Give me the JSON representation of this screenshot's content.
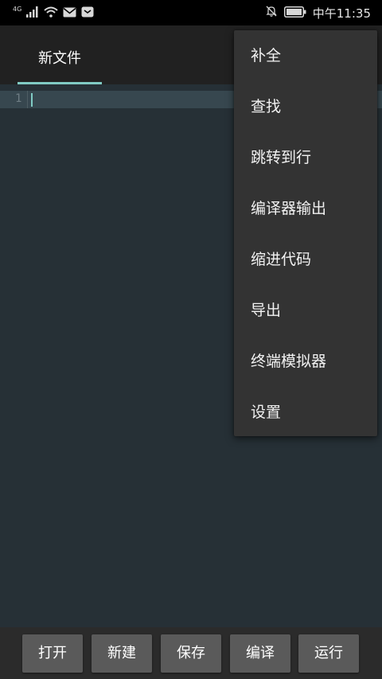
{
  "status_bar": {
    "network_label": "4G",
    "time": "中午11:35",
    "icons": [
      "signal-icon",
      "wifi-icon",
      "mail-icon",
      "notification-icon",
      "mute-icon",
      "battery-icon"
    ]
  },
  "tabs": [
    {
      "label": "新文件",
      "active": true
    }
  ],
  "editor": {
    "line_numbers": [
      "1"
    ],
    "content": ""
  },
  "menu": {
    "items": [
      {
        "label": "补全"
      },
      {
        "label": "查找"
      },
      {
        "label": "跳转到行"
      },
      {
        "label": "编译器输出"
      },
      {
        "label": "缩进代码"
      },
      {
        "label": "导出"
      },
      {
        "label": "终端模拟器"
      },
      {
        "label": "设置"
      }
    ]
  },
  "toolbar": {
    "buttons": [
      {
        "label": "打开"
      },
      {
        "label": "新建"
      },
      {
        "label": "保存"
      },
      {
        "label": "编译"
      },
      {
        "label": "运行"
      }
    ]
  },
  "colors": {
    "accent": "#80cbc4",
    "editor_bg": "#263036",
    "tab_bar_bg": "#212121",
    "menu_bg": "#333333",
    "button_bg": "#5a5a5a"
  }
}
